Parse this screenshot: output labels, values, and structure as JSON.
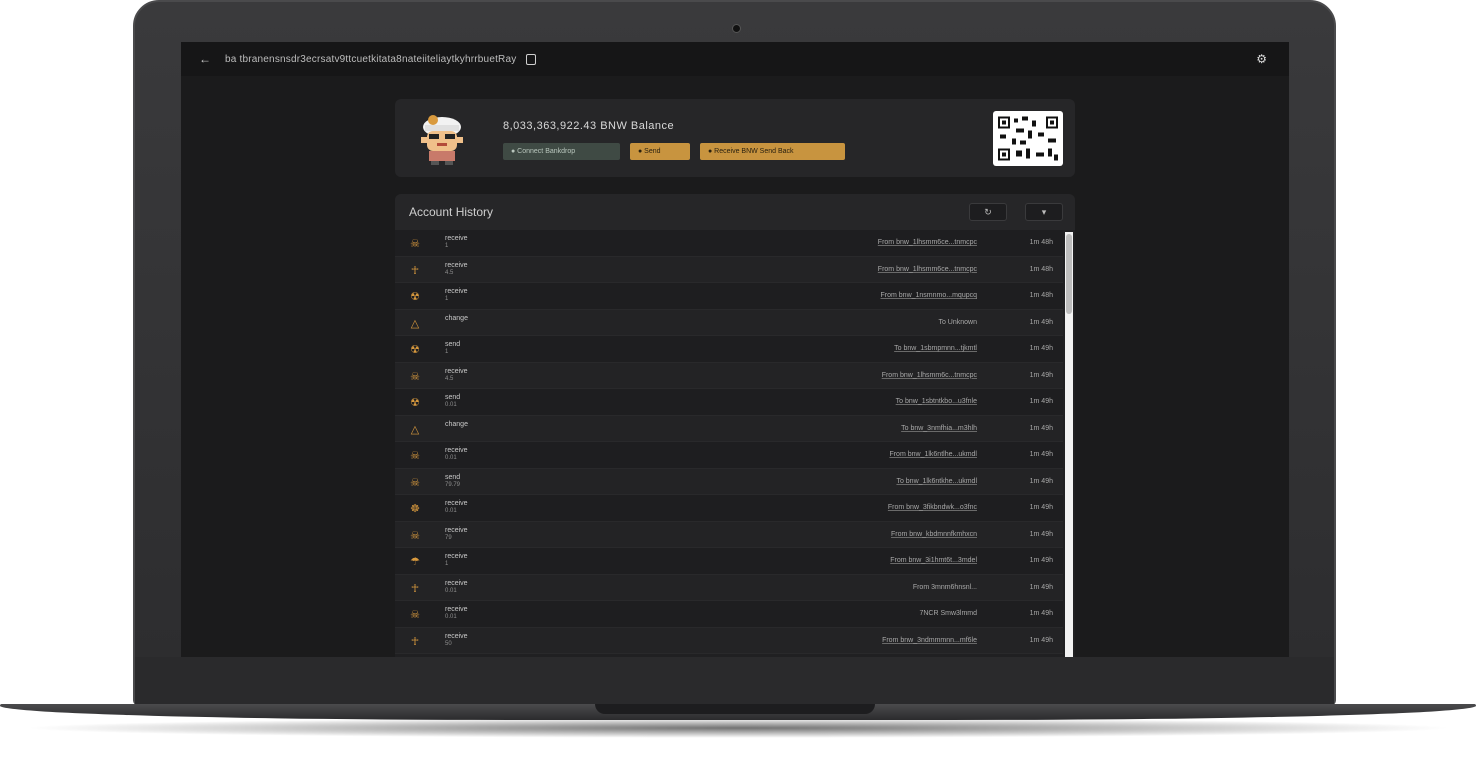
{
  "topbar": {
    "address": "ba  tbranensnsdr3ecrsatv9ttcuetkitata8nateiiteliaytkyhrrbuetRay",
    "back_icon": "arrow-left-icon",
    "copy_icon": "copy-icon",
    "settings_icon": "gear-icon"
  },
  "profile": {
    "balance": "8,033,363,922.43 BNW Balance",
    "buttons": {
      "green": "●  Connect Bankdrop",
      "gold1": "●  Send",
      "gold2": "●  Receive  BNW  Send  Back"
    },
    "colors": {
      "gold": "#c8943f",
      "panel": "#262628"
    }
  },
  "history": {
    "title": "Account History",
    "btn1": "↻",
    "btn2": "▾",
    "rows": [
      {
        "icon": "☠",
        "type": "receive",
        "sub": "1",
        "desc": "From  bnw_1lhsmm6ce...tnmcpc",
        "time": "1m 48h"
      },
      {
        "icon": "☥",
        "type": "receive",
        "sub": "4.5",
        "desc": "From  bnw_1lhsmm6ce...tnmcpc",
        "time": "1m 48h"
      },
      {
        "icon": "☢",
        "type": "receive",
        "sub": "1",
        "desc": "From  bnw_1nsmnmo...mqupcq",
        "time": "1m 48h"
      },
      {
        "icon": "△",
        "type": "change",
        "sub": "",
        "desc": "To  Unknown",
        "time": "1m 49h"
      },
      {
        "icon": "☢",
        "type": "send",
        "sub": "1",
        "desc": "To  bnw_1sbmpmnn...tjkmtl",
        "time": "1m 49h"
      },
      {
        "icon": "☠",
        "type": "receive",
        "sub": "4.5",
        "desc": "From  bnw_1lhsmm6c...tnmcpc",
        "time": "1m 49h"
      },
      {
        "icon": "☢",
        "type": "send",
        "sub": "0.01",
        "desc": "To  bnw_1sbtntkbo...u3fnle",
        "time": "1m 49h"
      },
      {
        "icon": "△",
        "type": "change",
        "sub": "",
        "desc": "To  bnw_3nmfhia...m3hlh",
        "time": "1m 49h"
      },
      {
        "icon": "☠",
        "type": "receive",
        "sub": "0.01",
        "desc": "From  bnw_1lk6ntlhe...ukmdl",
        "time": "1m 49h"
      },
      {
        "icon": "☠",
        "type": "send",
        "sub": "79.79",
        "desc": "To  bnw_1lk6ntkhe...ukmdl",
        "time": "1m 49h"
      },
      {
        "icon": "☸",
        "type": "receive",
        "sub": "0.01",
        "desc": "From  bnw_3fikbndwk...o3fnc",
        "time": "1m 49h"
      },
      {
        "icon": "☠",
        "type": "receive",
        "sub": "79",
        "desc": "From  bnw_kbdmnnfkmhxcn",
        "time": "1m 49h"
      },
      {
        "icon": "☂",
        "type": "receive",
        "sub": "1",
        "desc": "From  bnw_3i1hmt6t...3mdel",
        "time": "1m 49h"
      },
      {
        "icon": "☥",
        "type": "receive",
        "sub": "0.01",
        "desc": "From  3mnm6hnsnl...",
        "time": "1m 49h"
      },
      {
        "icon": "☠",
        "type": "receive",
        "sub": "0.01",
        "desc": "7NCR  Smw3lmmd",
        "time": "1m 49h"
      },
      {
        "icon": "☥",
        "type": "receive",
        "sub": "50",
        "desc": "From  bnw_3ndmmmnn...mf6le",
        "time": "1m 49h"
      }
    ]
  }
}
